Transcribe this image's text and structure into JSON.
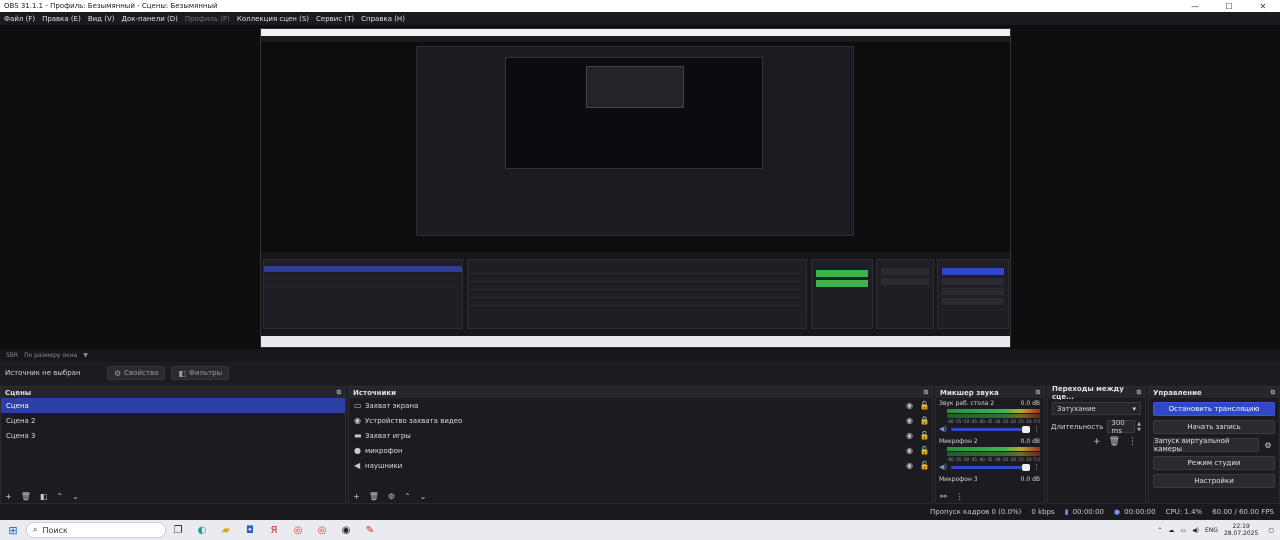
{
  "window": {
    "title": "OBS 31.1.1 - Профиль: Безымянный - Сцены: Безымянный",
    "min": "—",
    "max": "☐",
    "close": "✕"
  },
  "menu": [
    {
      "label": "Файл (F)",
      "enabled": true
    },
    {
      "label": "Правка (E)",
      "enabled": true
    },
    {
      "label": "Вид (V)",
      "enabled": true
    },
    {
      "label": "Док-панели (D)",
      "enabled": true
    },
    {
      "label": "Профиль (P)",
      "enabled": false
    },
    {
      "label": "Коллекция сцен (S)",
      "enabled": true
    },
    {
      "label": "Сервис (T)",
      "enabled": true
    },
    {
      "label": "Справка (H)",
      "enabled": true
    }
  ],
  "scene_bar": {
    "scale": "SBR",
    "view": "По размеру окна"
  },
  "source_bar": {
    "no_source": "Источник не выбран",
    "properties": "Свойства",
    "filters": "Фильтры"
  },
  "docks": {
    "scenes": {
      "title": "Сцены",
      "items": [
        "Сцена",
        "Сцена 2",
        "Сцена 3"
      ]
    },
    "sources": {
      "title": "Источники",
      "items": [
        {
          "label": "Захват экрана",
          "icon": "monitor-icon",
          "glyph": "▭"
        },
        {
          "label": "Устройство захвата видео",
          "icon": "camera-icon",
          "glyph": "◉"
        },
        {
          "label": "Захват игры",
          "icon": "gamepad-icon",
          "glyph": "▬"
        },
        {
          "label": "микрофон",
          "icon": "microphone-icon",
          "glyph": "●"
        },
        {
          "label": "наушники",
          "icon": "speaker-icon",
          "glyph": "◀"
        }
      ]
    },
    "mixer": {
      "title": "Микшер звука",
      "channels": [
        {
          "name": "Звук раб. стола 2",
          "db": "0.0 dB",
          "scale": "-60 -55 -50 -45 -40 -35 -30 -25 -20 -15 -10 -5 0"
        },
        {
          "name": "Микрофон 2",
          "db": "0.0 dB",
          "scale": "-60 -55 -50 -45 -40 -35 -30 -25 -20 -15 -10 -5 0"
        },
        {
          "name": "Микрофон 3",
          "db": "0.0 dB",
          "scale": ""
        }
      ]
    },
    "transitions": {
      "title": "Переходы между сце...",
      "selected": "Затухание",
      "duration_label": "Длительность",
      "duration_value": "300 ms"
    },
    "controls": {
      "title": "Управление",
      "stop_stream": "Остановить трансляцию",
      "start_record": "Начать запись",
      "virtual_cam": "Запуск виртуальной камеры",
      "studio_mode": "Режим студии",
      "settings": "Настройки"
    }
  },
  "status": {
    "dropped": "Пропуск кадров 0 (0.0%)",
    "kbps": "0 kbps",
    "time1": "00:00:00",
    "time2": "00:00:00",
    "cpu": "CPU: 1.4%",
    "fps": "60.00 / 60.00 FPS"
  },
  "taskbar": {
    "search": "Поиск",
    "lang": "ENG",
    "time": "22:19",
    "date": "28.07.2025"
  },
  "colors": {
    "accent": "#2f49c5",
    "scene_selected": "#2b3fa5",
    "bg": "#1b1b20"
  }
}
